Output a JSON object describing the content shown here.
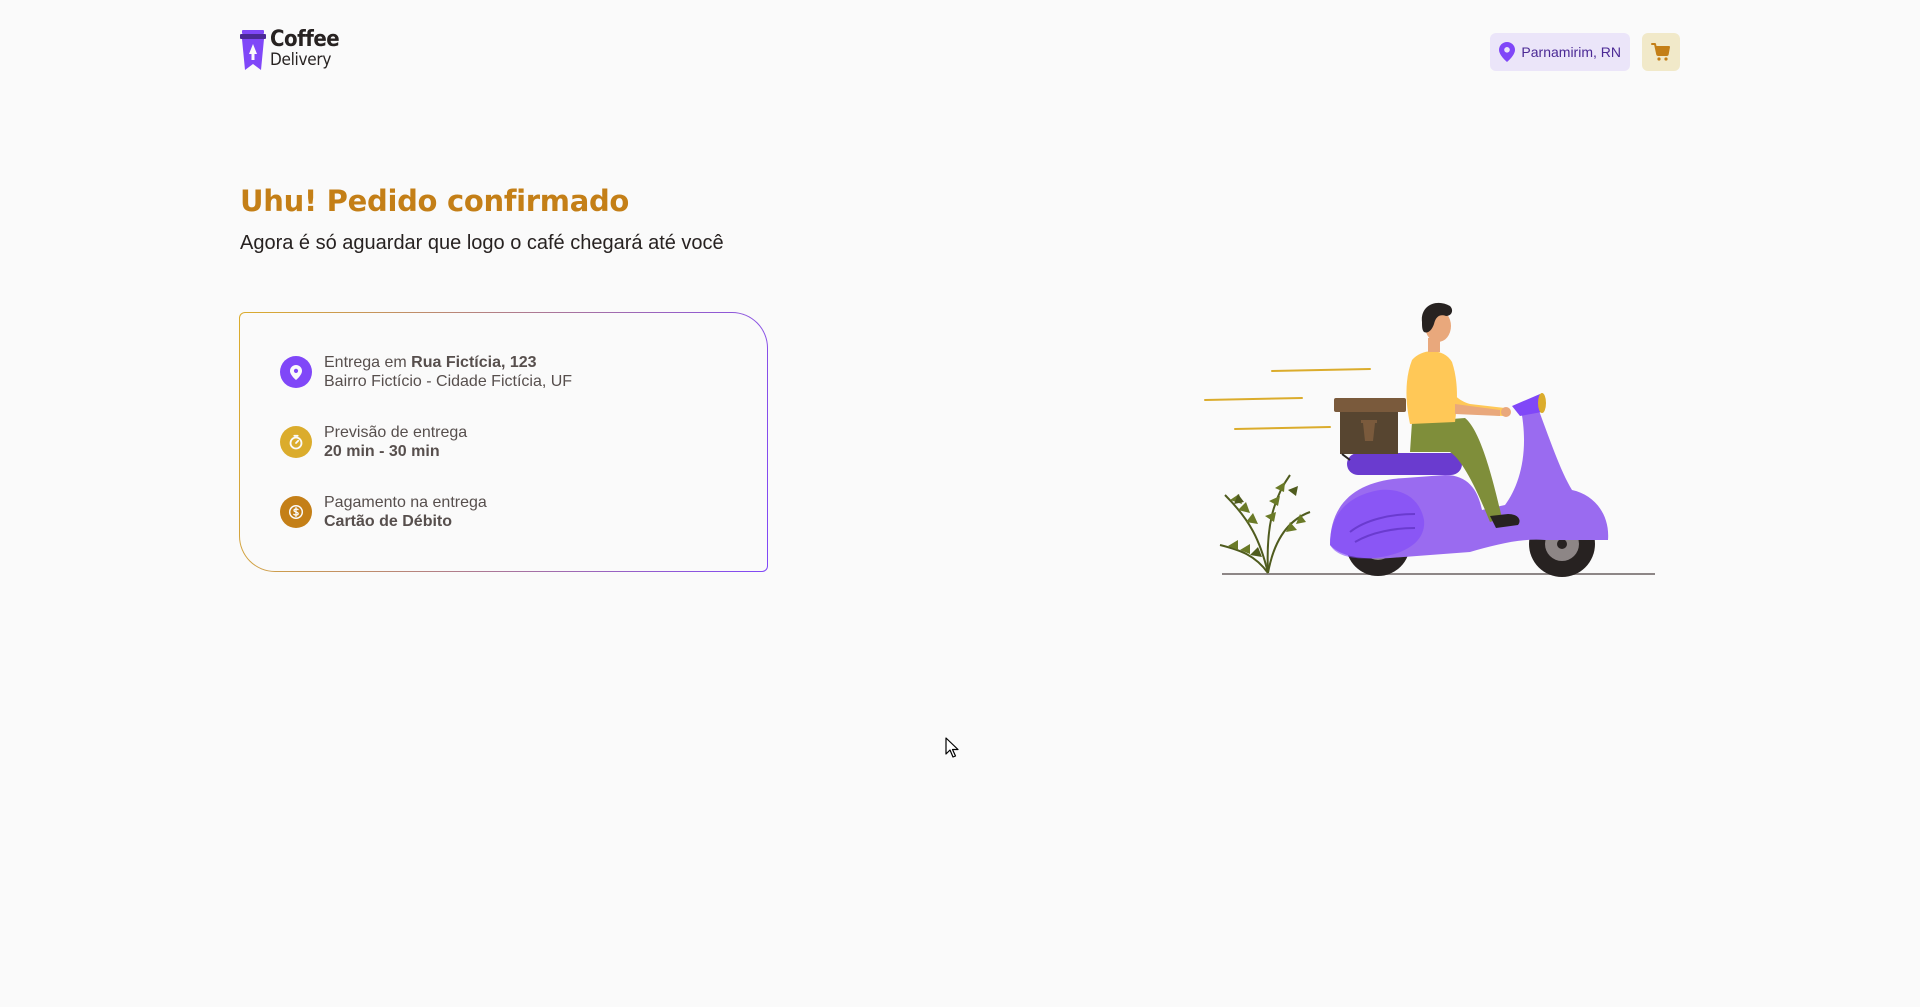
{
  "header": {
    "logo_line1": "Coffee",
    "logo_line2": "Delivery",
    "location": "Parnamirim, RN",
    "location_icon": "map-pin-icon",
    "cart_icon": "shopping-cart-icon"
  },
  "confirmation": {
    "title": "Uhu! Pedido confirmado",
    "subtitle": "Agora é só aguardar que logo o café chegará até você"
  },
  "details": {
    "delivery_prefix": "Entrega em ",
    "delivery_address": "Rua Fictícia, 123",
    "delivery_area": "Bairro Fictício - Cidade Fictícia, UF",
    "eta_label": "Previsão de entrega",
    "eta_value": "20 min - 30 min",
    "payment_label": "Pagamento na entrega",
    "payment_value": "Cartão de Débito"
  },
  "colors": {
    "brand_yellow_dark": "#C47F17",
    "brand_yellow": "#DBAC2C",
    "brand_purple": "#8047F8",
    "brand_purple_dark": "#4B2995",
    "purple_light": "#EBE5F9",
    "yellow_light": "#F1E9C9"
  }
}
